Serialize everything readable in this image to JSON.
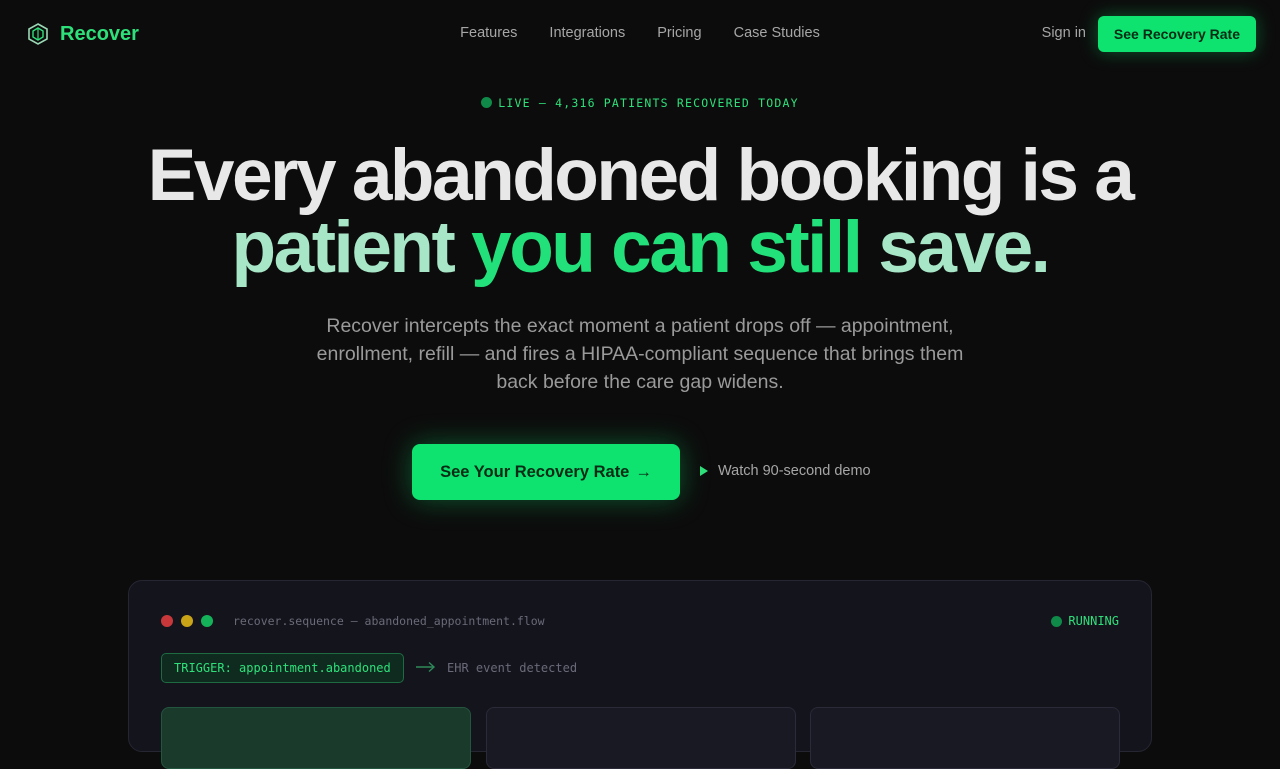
{
  "nav": {
    "brand": "Recover",
    "links": [
      "Features",
      "Integrations",
      "Pricing",
      "Case Studies"
    ],
    "sign_in": "Sign in",
    "cta": "See Recovery Rate"
  },
  "hero": {
    "live_badge": "LIVE — 4,316 PATIENTS RECOVERED TODAY",
    "headline_line1": "Every abandoned booking is a",
    "headline_line2_a": "patient ",
    "headline_line2_b": "you can still",
    "headline_line2_c": " save.",
    "subtext": "Recover intercepts the exact moment a patient drops off — appointment, enrollment, refill — and fires a HIPAA-compliant sequence that brings them back before the care gap widens.",
    "cta_label": "See Your Recovery Rate",
    "cta_arrow": "→",
    "demo_label": "Watch 90-second demo"
  },
  "panel": {
    "title": "recover.sequence — abandoned_appointment.flow",
    "status": "RUNNING",
    "trigger": "TRIGGER: appointment.abandoned",
    "event": "EHR event detected",
    "window_dot_colors": [
      "#c8383b",
      "#c8a416",
      "#14b35a"
    ]
  },
  "colors": {
    "accent": "#0ee36f",
    "background": "#0c0c0c"
  }
}
